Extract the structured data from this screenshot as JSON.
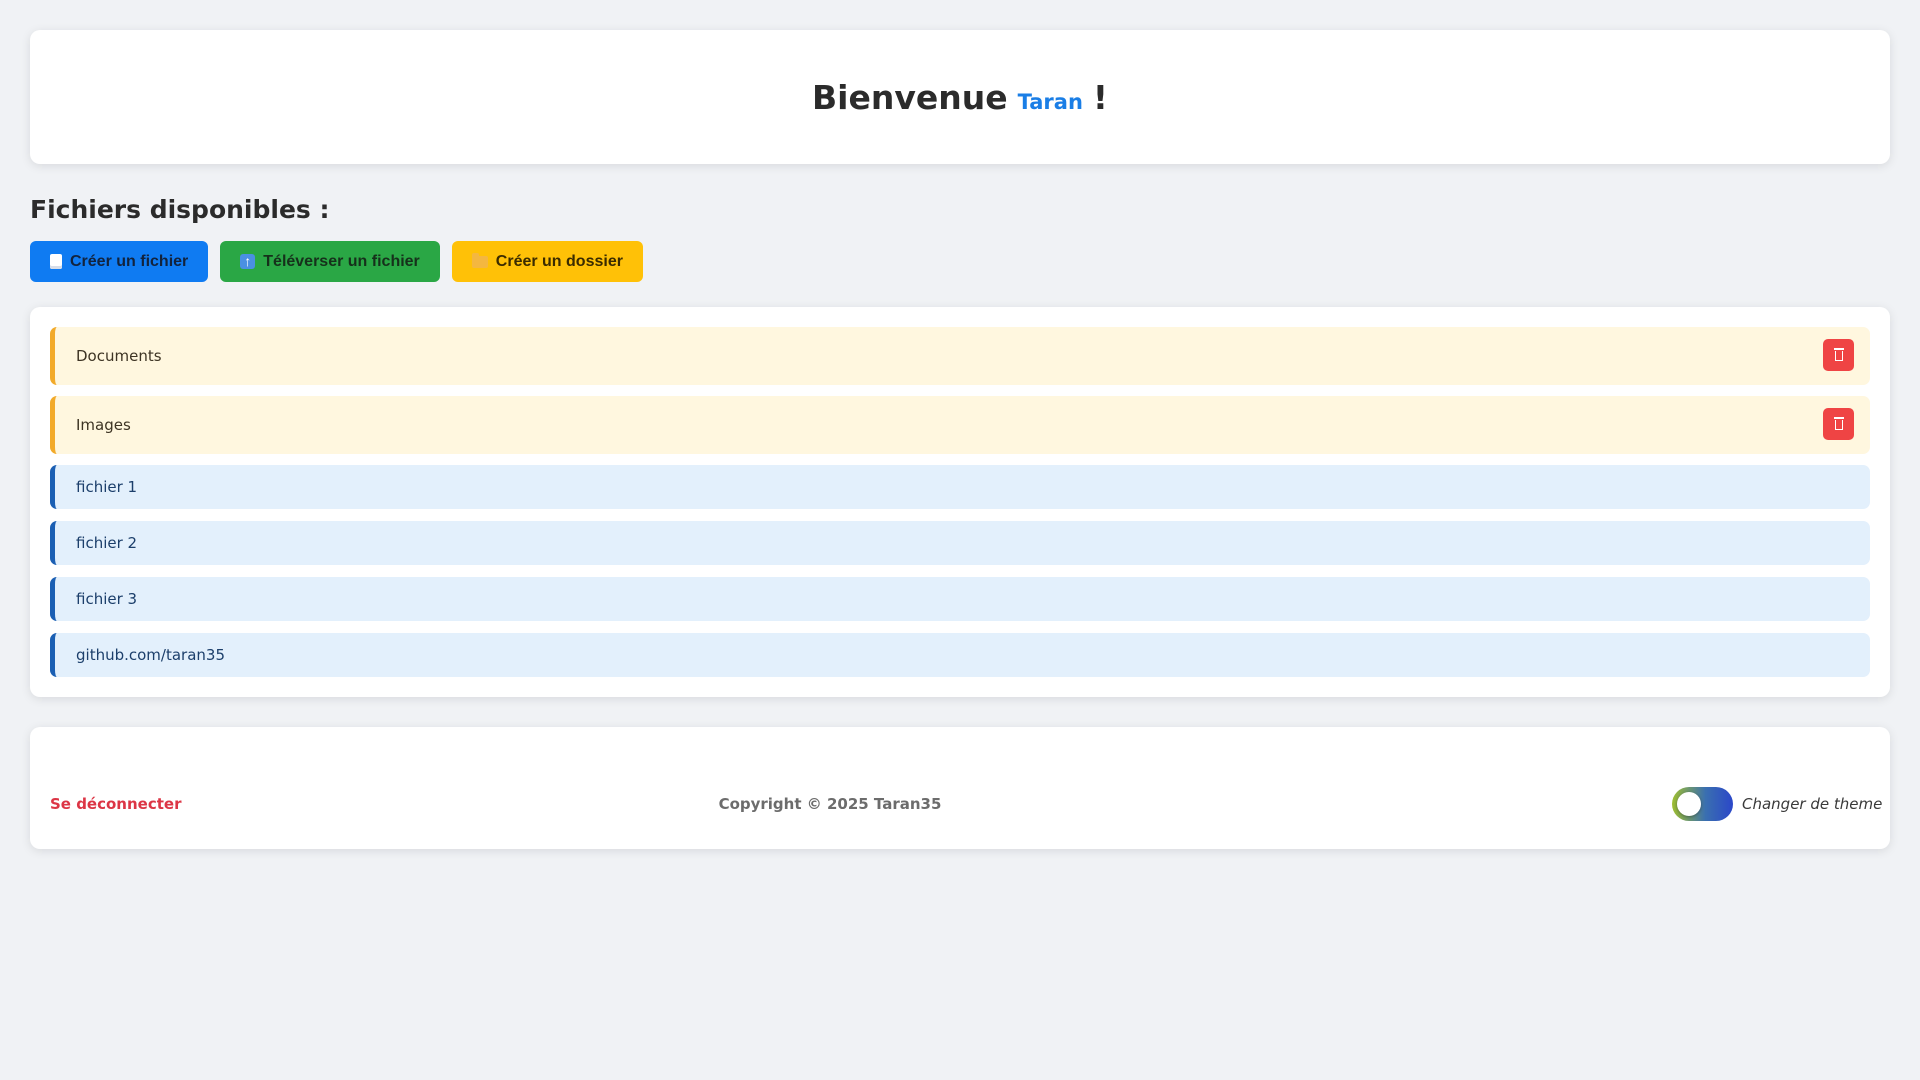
{
  "header": {
    "welcome": "Bienvenue",
    "username": "Taran",
    "exclamation": "!"
  },
  "section": {
    "title": "Fichiers disponibles :"
  },
  "actions": {
    "create_file": "Créer un fichier",
    "upload_file": "Téléverser un fichier",
    "create_folder": "Créer un dossier"
  },
  "folders": [
    {
      "name": "Documents"
    },
    {
      "name": "Images"
    }
  ],
  "files": [
    {
      "name": "fichier 1"
    },
    {
      "name": "fichier 2"
    },
    {
      "name": "fichier 3"
    },
    {
      "name": "github.com/taran35"
    }
  ],
  "footer": {
    "logout": "Se déconnecter",
    "copyright": "Copyright © 2025 Taran35",
    "theme_label": "Changer de theme"
  },
  "colors": {
    "background": "#f0f2f5",
    "accent_blue": "#0f7bf2",
    "accent_green": "#2aa745",
    "accent_yellow": "#ffc107",
    "danger": "#dc3545",
    "folder_bg": "#fff7df",
    "file_bg": "#e3f0fc"
  }
}
